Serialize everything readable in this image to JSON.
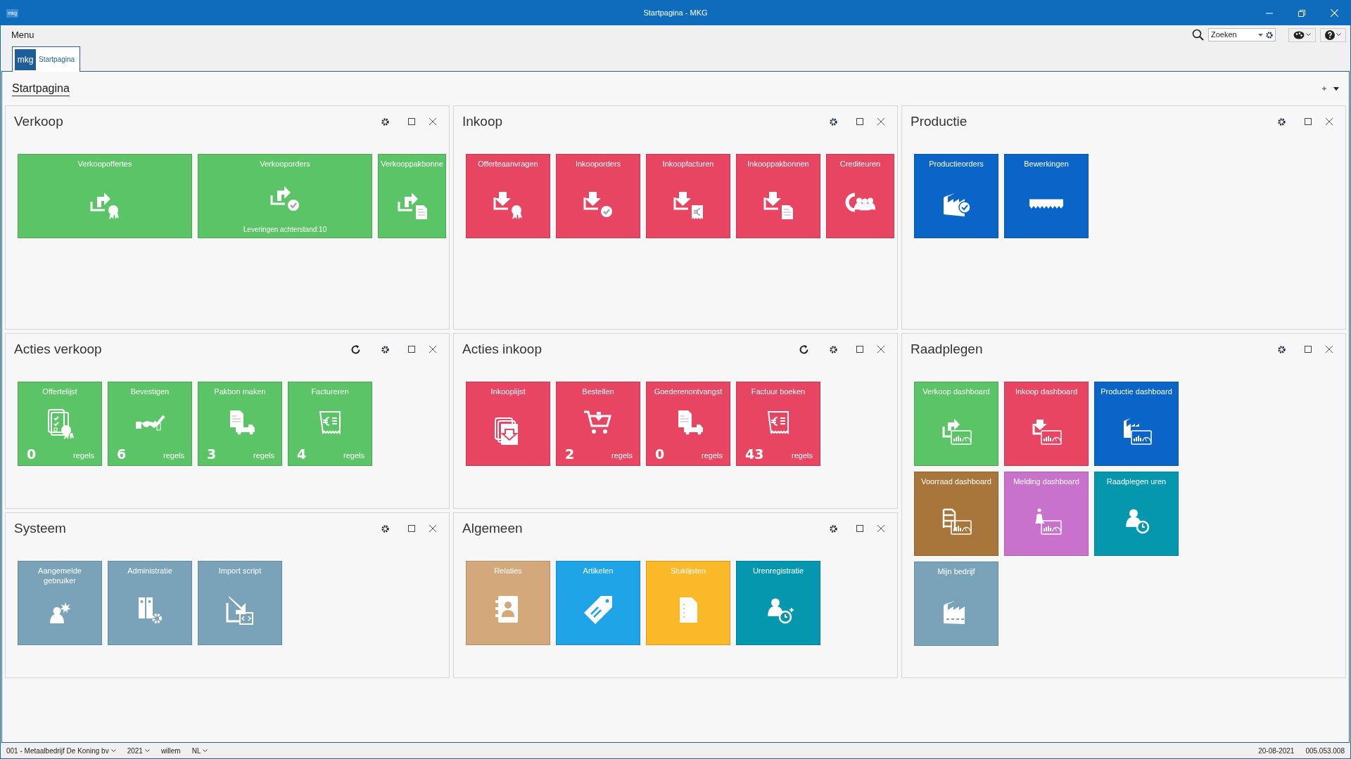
{
  "window": {
    "title": "Startpagina - MKG",
    "logo": "mkg"
  },
  "menu_bar": {
    "menu": "Menu",
    "search": {
      "value": "Zoeken"
    }
  },
  "tabs": [
    {
      "logo": "mkg",
      "label": "Startpagina",
      "selected": true
    }
  ],
  "page_title": "Startpagina",
  "panels": [
    {
      "title": "Verkoop",
      "refresh": false,
      "tiles": [
        {
          "label": "Verkoopoffertes",
          "color": "#5bc466"
        },
        {
          "label": "Verkooporders",
          "color": "#5bc466",
          "note": "Leveringen achterstand:10"
        },
        {
          "label": "Verkooppakbonne",
          "color": "#5bc466"
        }
      ]
    },
    {
      "title": "Inkoop",
      "refresh": false,
      "tiles": [
        {
          "label": "Offerteaanvragen",
          "color": "#e84562"
        },
        {
          "label": "Inkooporders",
          "color": "#e84562"
        },
        {
          "label": "Inkoopfacturen",
          "color": "#e84562"
        },
        {
          "label": "Inkooppakbonnen",
          "color": "#e84562"
        },
        {
          "label": "Crediteuren",
          "color": "#e84562"
        }
      ]
    },
    {
      "title": "Productie",
      "refresh": false,
      "tiles": [
        {
          "label": "Productieorders",
          "color": "#0b64c8"
        },
        {
          "label": "Bewerkingen",
          "color": "#0b64c8"
        }
      ]
    },
    {
      "title": "Acties verkoop",
      "refresh": true,
      "tiles": [
        {
          "label": "Offertelijst",
          "color": "#5bc466",
          "count": "0",
          "unit": "regels"
        },
        {
          "label": "Bevestigen",
          "color": "#5bc466",
          "count": "6",
          "unit": "regels"
        },
        {
          "label": "Pakbon maken",
          "color": "#5bc466",
          "count": "3",
          "unit": "regels"
        },
        {
          "label": "Factureren",
          "color": "#5bc466",
          "count": "4",
          "unit": "regels"
        }
      ]
    },
    {
      "title": "Acties inkoop",
      "refresh": true,
      "tiles": [
        {
          "label": "Inkooplijst",
          "color": "#e84562"
        },
        {
          "label": "Bestellen",
          "color": "#e84562",
          "count": "2",
          "unit": "regels"
        },
        {
          "label": "Goederenontvangst",
          "color": "#e84562",
          "count": "0",
          "unit": "regels"
        },
        {
          "label": "Factuur boeken",
          "color": "#e84562",
          "count": "43",
          "unit": "regels"
        }
      ]
    },
    {
      "title": "Raadplegen",
      "refresh": false,
      "tiles": [
        {
          "label": "Verkoop dashboard",
          "color": "#5bc466"
        },
        {
          "label": "Inkoop dashboard",
          "color": "#e84562"
        },
        {
          "label": "Productie dashboard",
          "color": "#0b64c8"
        },
        {
          "label": "Voorraad dashboard",
          "color": "#a8763a"
        },
        {
          "label": "Melding dashboard",
          "color": "#c872cd"
        },
        {
          "label": "Raadplegen uren",
          "color": "#0597ae"
        },
        {
          "label": "Mijn bedrijf",
          "color": "#7aa3b9"
        }
      ]
    },
    {
      "title": "Systeem",
      "refresh": false,
      "tiles": [
        {
          "label": "Aangemelde gebruiker",
          "color": "#7aa3b9"
        },
        {
          "label": "Administratie",
          "color": "#7aa3b9"
        },
        {
          "label": "Import script",
          "color": "#7aa3b9"
        }
      ]
    },
    {
      "title": "Algemeen",
      "refresh": false,
      "tiles": [
        {
          "label": "Relaties",
          "color": "#d3a97c"
        },
        {
          "label": "Artikelen",
          "color": "#1fa4e8"
        },
        {
          "label": "Stuklijsten",
          "color": "#fbb829"
        },
        {
          "label": "Urenregistratie",
          "color": "#0597ae"
        }
      ]
    }
  ],
  "status_bar": {
    "company": "001 - Metaalbedrijf De Koning bv",
    "year": "2021",
    "user": "willem",
    "language": "NL",
    "date": "20-08-2021",
    "version": "005.053.008"
  }
}
